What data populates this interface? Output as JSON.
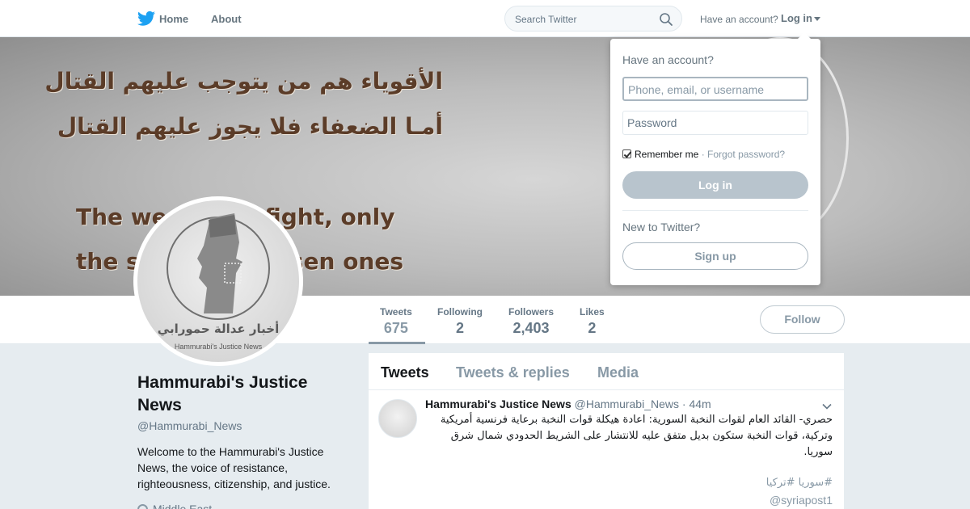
{
  "nav": {
    "home_label": "Home",
    "about_label": "About",
    "search_placeholder": "Search Twitter",
    "account_question": "Have an account?",
    "login_label": "Log in"
  },
  "banner": {
    "arabic_line1": "الأقوياء هم من يتوجب عليهم القتال",
    "arabic_line2": "أمـا الضعفاء فلا يجوز عليهم القتال",
    "english_line1": "The we        ot fight, only",
    "english_line2": "the st            chosen ones"
  },
  "avatar": {
    "arabic_text": "أخبار عدالة حمورابي",
    "english_text": "Hammurabi's Justice News"
  },
  "stats": [
    {
      "label": "Tweets",
      "value": "675"
    },
    {
      "label": "Following",
      "value": "2"
    },
    {
      "label": "Followers",
      "value": "2,403"
    },
    {
      "label": "Likes",
      "value": "2"
    }
  ],
  "follow_label": "Follow",
  "profile": {
    "name": "Hammurabi's Justice News",
    "handle": "@Hammurabi_News",
    "bio": "Welcome to the Hammurabi's Justice News, the voice of resistance, righteousness, citizenship, and justice.",
    "location": "Middle East"
  },
  "timeline": {
    "tabs": [
      "Tweets",
      "Tweets & replies",
      "Media"
    ]
  },
  "tweet": {
    "name": "Hammurabi's Justice News",
    "handle": "@Hammurabi_News",
    "dot": "·",
    "time": "44m",
    "body": "حصري- القائد العام لقوات النخبة السورية: اعادة هيكلة قوات النخبة برعاية فرنسية أمريكية وتركية، قوات النخبة ستكون بديل متفق عليه للانتشار على الشريط الحدودي شمال شرق سوريا.",
    "hashtags": "#سوريا #تركيا",
    "mention": "@syriapost1"
  },
  "login_dropdown": {
    "title": "Have an account?",
    "username_placeholder": "Phone, email, or username",
    "password_placeholder": "Password",
    "remember_label": "Remember me",
    "separator": "·",
    "forgot_label": "Forgot password?",
    "login_button": "Log in",
    "new_label": "New to Twitter?",
    "signup_button": "Sign up"
  },
  "colors": {
    "twitter_blue": "#1da1f2",
    "muted_gray": "#657786",
    "login_button_bg": "#b8c4cd"
  }
}
